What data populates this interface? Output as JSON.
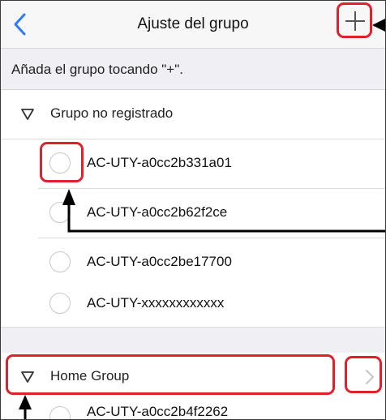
{
  "navbar": {
    "title": "Ajuste del grupo",
    "back_icon": "chevron-left-icon",
    "add_icon": "plus-icon"
  },
  "hint": {
    "text": "Añada el grupo tocando \"+\"."
  },
  "sections": [
    {
      "label": "Grupo no registrado",
      "expanded": true,
      "items": [
        {
          "label": "AC-UTY-a0cc2b331a01",
          "selected": false
        },
        {
          "label": "AC-UTY-a0cc2b62f2ce",
          "selected": false
        },
        {
          "label": "AC-UTY-a0cc2be17700",
          "selected": false
        },
        {
          "label": "AC-UTY-xxxxxxxxxxxx",
          "selected": false
        }
      ]
    },
    {
      "label": "Home Group",
      "expanded": true,
      "items": [
        {
          "label": "AC-UTY-a0cc2b4f2262",
          "selected": false
        }
      ]
    }
  ],
  "colors": {
    "accent": "#2e7cf6",
    "annotation": "#e0212b",
    "arrow": "#000000",
    "section_bg": "#efeff4"
  }
}
